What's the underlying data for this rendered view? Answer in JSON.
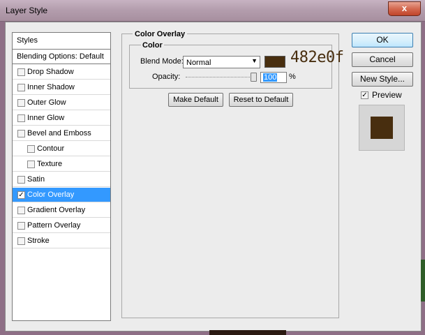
{
  "window": {
    "title": "Layer Style",
    "close_glyph": "x"
  },
  "styles_list": [
    {
      "label": "Styles",
      "kind": "header",
      "checked": false
    },
    {
      "label": "Blending Options: Default",
      "kind": "blending",
      "checked": false
    },
    {
      "label": "Drop Shadow",
      "kind": "item",
      "checked": false
    },
    {
      "label": "Inner Shadow",
      "kind": "item",
      "checked": false
    },
    {
      "label": "Outer Glow",
      "kind": "item",
      "checked": false
    },
    {
      "label": "Inner Glow",
      "kind": "item",
      "checked": false
    },
    {
      "label": "Bevel and Emboss",
      "kind": "item",
      "checked": false
    },
    {
      "label": "Contour",
      "kind": "sub",
      "checked": false
    },
    {
      "label": "Texture",
      "kind": "sub",
      "checked": false
    },
    {
      "label": "Satin",
      "kind": "item",
      "checked": false
    },
    {
      "label": "Color Overlay",
      "kind": "item",
      "checked": true,
      "selected": true
    },
    {
      "label": "Gradient Overlay",
      "kind": "item",
      "checked": false
    },
    {
      "label": "Pattern Overlay",
      "kind": "item",
      "checked": false
    },
    {
      "label": "Stroke",
      "kind": "item",
      "checked": false
    }
  ],
  "panel": {
    "group_title": "Color Overlay",
    "subgroup_title": "Color",
    "blend_mode_label": "Blend Mode:",
    "blend_mode_value": "Normal",
    "overlay_color": "#482e0f",
    "hex_annotation": "482e0f",
    "opacity_label": "Opacity:",
    "opacity_value": "100",
    "opacity_unit": "%",
    "make_default_label": "Make Default",
    "reset_default_label": "Reset to Default"
  },
  "actions": {
    "ok_label": "OK",
    "cancel_label": "Cancel",
    "new_style_label": "New Style..."
  },
  "preview": {
    "label": "Preview",
    "checked": true,
    "color": "#482e0f"
  },
  "colors": {
    "selection": "#3399ff",
    "accent_button": "#3c7fb1"
  }
}
